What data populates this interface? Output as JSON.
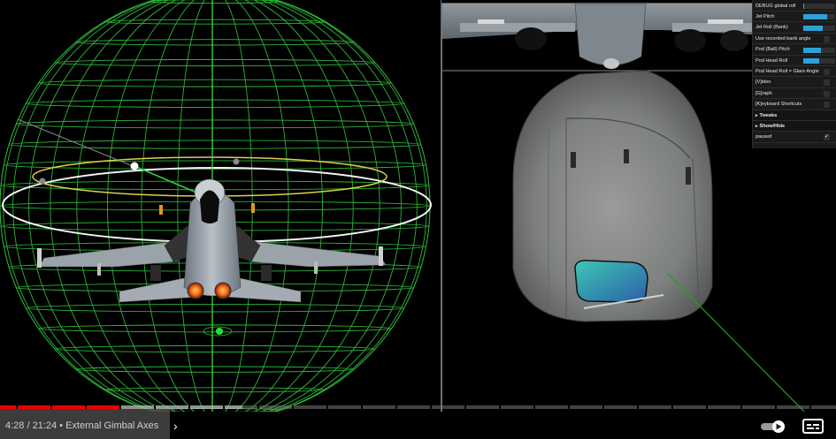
{
  "gui": {
    "rows": [
      {
        "label": "DEBUG global roll",
        "control": "slider",
        "level": 0.03
      },
      {
        "label": "Jet Pitch",
        "control": "slider",
        "level": 0.75
      },
      {
        "label": "Jet Roll (Bank)",
        "control": "slider",
        "level": 0.6
      },
      {
        "label": "Use recorded bank angle",
        "control": "checkbox",
        "checked": false
      },
      {
        "label": "Pod (Ball) Pitch",
        "control": "slider",
        "level": 0.55
      },
      {
        "label": "Pod Head Roll",
        "control": "slider",
        "level": 0.5
      },
      {
        "label": "Pod Head Roll = Glare Angle",
        "control": "checkbox",
        "checked": false
      },
      {
        "label": "[V]ideo",
        "control": "checkbox",
        "checked": false
      },
      {
        "label": "[G]raph",
        "control": "checkbox",
        "checked": false
      },
      {
        "label": "[K]eyboard Shortcuts",
        "control": "checkbox",
        "checked": false
      }
    ],
    "folders": [
      "Tweaks",
      "Show/Hide"
    ],
    "paused_label": "paused",
    "paused_checked": true,
    "checkmark": "✓",
    "folder_arrow": "▸"
  },
  "player": {
    "current_time": "4:28",
    "separator": " / ",
    "duration": "21:24",
    "bullet": " • ",
    "chapter_title": "External Gimbal Axes",
    "chapter_icon": "chevron-right-icon",
    "chevron_glyph": "›",
    "progress_played_fraction": 0.144,
    "progress_buffered_fraction": 0.29,
    "autoplay_on": true,
    "captions_icon": "captions-icon"
  },
  "colors": {
    "globe_grid": "#2fbf3a",
    "equator_ring": "#f0f0f0",
    "yellow_ring": "#d9d24a",
    "slider_fill": "#2fa1d6",
    "progress_red": "#ff0000",
    "panel_bg": "#1a1a1a"
  }
}
